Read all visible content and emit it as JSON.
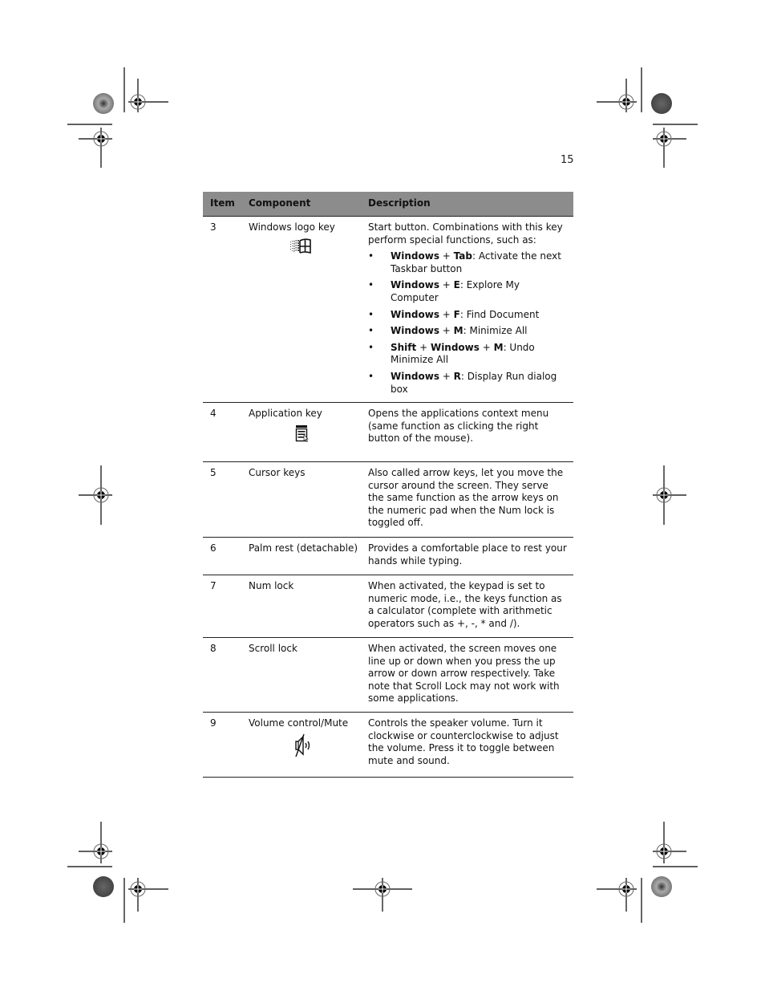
{
  "page": {
    "number": "15"
  },
  "table": {
    "headers": {
      "item": "Item",
      "component": "Component",
      "description": "Description"
    },
    "rows": [
      {
        "item": "3",
        "component": "Windows logo key",
        "icon": "windows-logo-icon",
        "description": "Start button.  Combinations with this key perform special functions, such as:",
        "bullets": [
          {
            "keys": [
              "Windows",
              "Tab"
            ],
            "text": ":  Activate the next Taskbar button"
          },
          {
            "keys": [
              "Windows",
              "E"
            ],
            "text": ":  Explore My Computer"
          },
          {
            "keys": [
              "Windows",
              "F"
            ],
            "text": ":  Find Document"
          },
          {
            "keys": [
              "Windows",
              "M"
            ],
            "text": ":  Minimize All"
          },
          {
            "keys": [
              "Shift",
              "Windows",
              "M"
            ],
            "text": ":  Undo Minimize All"
          },
          {
            "keys": [
              "Windows",
              "R"
            ],
            "text": ":  Display Run dialog box"
          }
        ]
      },
      {
        "item": "4",
        "component": "Application key",
        "icon": "application-menu-icon",
        "description": "Opens the applications context menu (same function as clicking the right button of the mouse)."
      },
      {
        "item": "5",
        "component": "Cursor keys",
        "description": "Also called arrow keys, let you move the cursor around the screen. They serve the same function as the arrow keys on the numeric pad when the Num lock is toggled off."
      },
      {
        "item": "6",
        "component": "Palm rest (detachable)",
        "description": "Provides a comfortable place to rest your hands while typing."
      },
      {
        "item": "7",
        "component": "Num lock",
        "description": "When activated, the keypad is set to numeric mode, i.e., the keys function as a calculator (complete with arithmetic operators such as +, -, * and /)."
      },
      {
        "item": "8",
        "component": "Scroll lock",
        "description": "When activated, the screen moves one line up or down when you press the up arrow or down arrow respectively. Take note that Scroll Lock may not work with some applications."
      },
      {
        "item": "9",
        "component": "Volume control/Mute",
        "icon": "speaker-mute-icon",
        "description": "Controls the speaker volume. Turn it clockwise or counterclockwise to adjust the volume. Press it to toggle between mute and sound."
      }
    ]
  }
}
